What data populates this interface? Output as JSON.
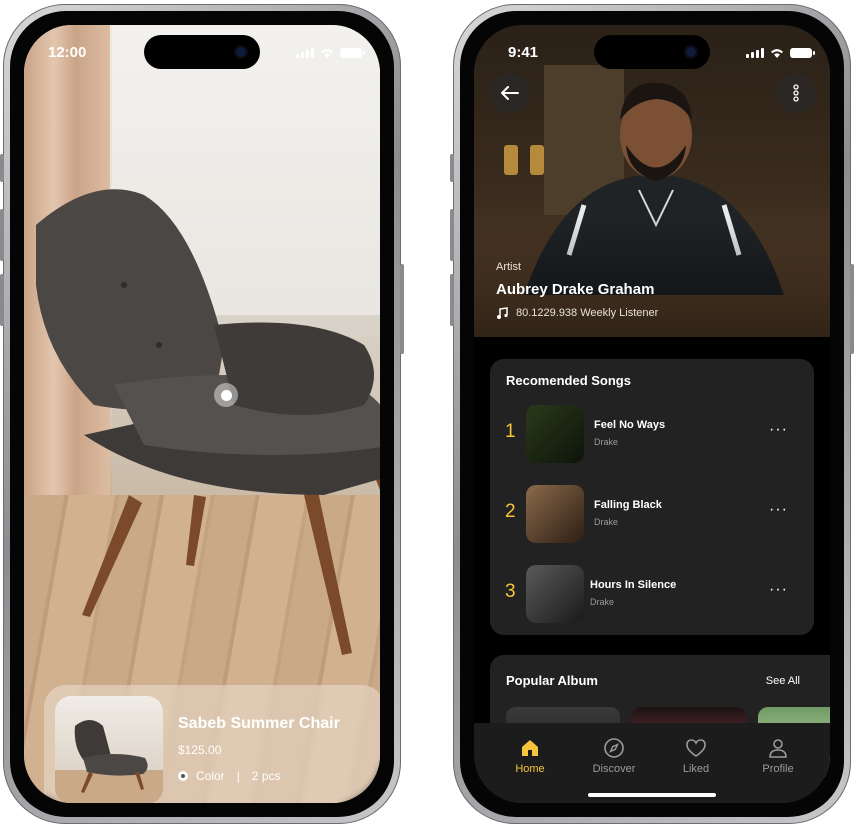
{
  "left_phone": {
    "status_time": "12:00",
    "product": {
      "name": "Sabeb Summer Chair",
      "price": "$125.00",
      "color_label": "Color",
      "separator": "|",
      "quantity": "2 pcs"
    }
  },
  "right_phone": {
    "status_time": "9:41",
    "artist": {
      "tag": "Artist",
      "name": "Aubrey Drake Graham",
      "listeners": "80.1229.938 Weekly Listener"
    },
    "recommended": {
      "title": "Recomended Songs",
      "songs": [
        {
          "rank": "1",
          "title": "Feel No Ways",
          "artist": "Drake",
          "more": "···"
        },
        {
          "rank": "2",
          "title": "Falling Black",
          "artist": "Drake",
          "more": "···"
        },
        {
          "rank": "3",
          "title": "Hours In Silence",
          "artist": "Drake",
          "more": "···"
        }
      ]
    },
    "popular": {
      "title": "Popular Album",
      "see_all": "See All"
    },
    "tabs": [
      {
        "label": "Home",
        "icon": "home-icon",
        "active": true
      },
      {
        "label": "Discover",
        "icon": "compass-icon",
        "active": false
      },
      {
        "label": "Liked",
        "icon": "heart-icon",
        "active": false
      },
      {
        "label": "Profile",
        "icon": "user-icon",
        "active": false
      }
    ],
    "accent_color": "#f6c53b"
  }
}
